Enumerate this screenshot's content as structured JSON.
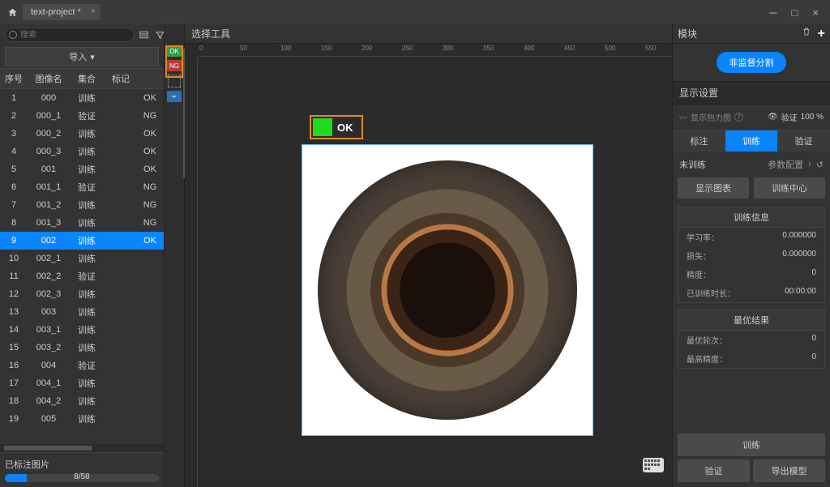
{
  "titlebar": {
    "project_name": "text-project *"
  },
  "left": {
    "search_placeholder": "搜索",
    "import_label": "导入",
    "columns": {
      "seq": "序号",
      "name": "图像名",
      "set": "集合",
      "mark": "标记",
      "result": ""
    },
    "rows": [
      {
        "seq": "1",
        "name": "000",
        "set": "训练",
        "mark": "",
        "res": "OK"
      },
      {
        "seq": "2",
        "name": "000_1",
        "set": "验证",
        "mark": "",
        "res": "NG"
      },
      {
        "seq": "3",
        "name": "000_2",
        "set": "训练",
        "mark": "",
        "res": "OK"
      },
      {
        "seq": "4",
        "name": "000_3",
        "set": "训练",
        "mark": "",
        "res": "OK"
      },
      {
        "seq": "5",
        "name": "001",
        "set": "训练",
        "mark": "",
        "res": "OK"
      },
      {
        "seq": "6",
        "name": "001_1",
        "set": "验证",
        "mark": "",
        "res": "NG"
      },
      {
        "seq": "7",
        "name": "001_2",
        "set": "训练",
        "mark": "",
        "res": "NG"
      },
      {
        "seq": "8",
        "name": "001_3",
        "set": "训练",
        "mark": "",
        "res": "NG"
      },
      {
        "seq": "9",
        "name": "002",
        "set": "训练",
        "mark": "",
        "res": "OK"
      },
      {
        "seq": "10",
        "name": "002_1",
        "set": "训练",
        "mark": "",
        "res": ""
      },
      {
        "seq": "11",
        "name": "002_2",
        "set": "验证",
        "mark": "",
        "res": ""
      },
      {
        "seq": "12",
        "name": "002_3",
        "set": "训练",
        "mark": "",
        "res": ""
      },
      {
        "seq": "13",
        "name": "003",
        "set": "训练",
        "mark": "",
        "res": ""
      },
      {
        "seq": "14",
        "name": "003_1",
        "set": "训练",
        "mark": "",
        "res": ""
      },
      {
        "seq": "15",
        "name": "003_2",
        "set": "训练",
        "mark": "",
        "res": ""
      },
      {
        "seq": "16",
        "name": "004",
        "set": "验证",
        "mark": "",
        "res": ""
      },
      {
        "seq": "17",
        "name": "004_1",
        "set": "训练",
        "mark": "",
        "res": ""
      },
      {
        "seq": "18",
        "name": "004_2",
        "set": "训练",
        "mark": "",
        "res": ""
      },
      {
        "seq": "19",
        "name": "005",
        "set": "训练",
        "mark": "",
        "res": ""
      }
    ],
    "selected_index": 8,
    "progress_label": "已标注图片",
    "progress_text": "8/58"
  },
  "toolstrip": {
    "ok": "OK",
    "ng": "NG"
  },
  "canvas": {
    "header": "选择工具",
    "ok_label": "OK",
    "ruler_ticks": [
      "0",
      "50",
      "100",
      "150",
      "200",
      "250",
      "300",
      "350",
      "400",
      "450",
      "500",
      "550"
    ]
  },
  "right": {
    "module_title": "模块",
    "blue_pill": "非监督分割",
    "display_title": "显示设置",
    "heatmap_label": "显示热力图",
    "validate_label": "验证",
    "validate_pct": "100 %",
    "tabs": {
      "annotate": "标注",
      "train": "训练",
      "validate": "验证"
    },
    "train_status": "未训练",
    "param_cfg": "参数配置",
    "show_chart": "显示图表",
    "train_center": "训练中心",
    "train_info_title": "训练信息",
    "train_info": {
      "lr_label": "学习率：",
      "lr": "0.000000",
      "loss_label": "损失：",
      "loss": "0.000000",
      "acc_label": "精度：",
      "acc": "0",
      "dur_label": "已训练时长：",
      "dur": "00:00:00"
    },
    "best_title": "最优结果",
    "best": {
      "epoch_label": "最优轮次：",
      "epoch": "0",
      "acc_label": "最高精度：",
      "acc": "0"
    },
    "actions": {
      "train": "训练",
      "validate": "验证",
      "export": "导出模型"
    }
  }
}
